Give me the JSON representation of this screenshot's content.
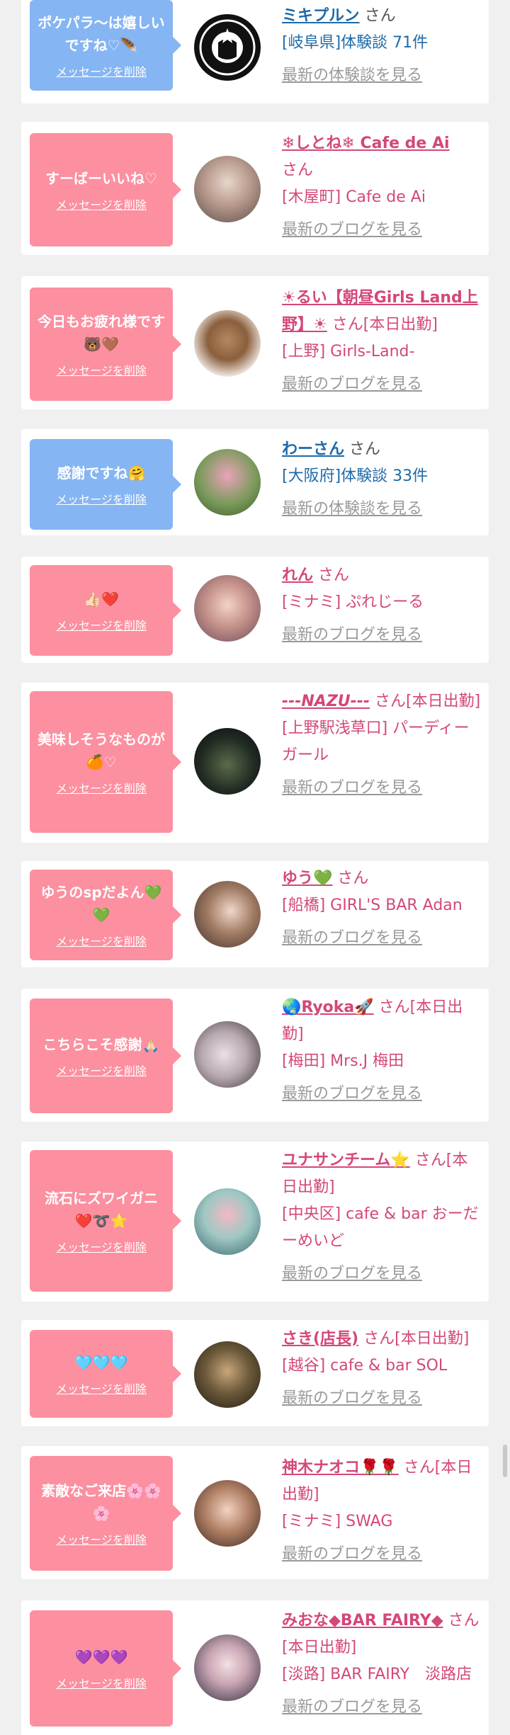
{
  "delete_label": "メッセージを削除",
  "colors": {
    "pink": "#fc8fa0",
    "blue": "#85b5f3",
    "name_pink": "#d4477a",
    "name_blue": "#1f6aa8"
  },
  "cards": [
    {
      "message": "ポケパラ〜は嬉しいですね♡🪶",
      "name": "ミキプルン",
      "suffix": "さん",
      "shop": "[岐阜県]体験談 71件",
      "link": "最新の体験談を見る",
      "avatar_icon": "starbucks-logo"
    },
    {
      "message": "すーばーいいね♡",
      "name": "❄しとね❄ Cafe de Ai",
      "suffix": "さん",
      "shop": "[木屋町] Cafe de Ai",
      "link": "最新のブログを見る",
      "avatar_icon": "profile-photo"
    },
    {
      "message": "今日もお疲れ様です🐻🤎",
      "name": "☀るい【朝昼Girls Land上野】☀",
      "suffix": "さん[本日出勤]",
      "shop": "[上野] Girls-Land-",
      "link": "最新のブログを見る",
      "avatar_icon": "bear-photo"
    },
    {
      "message": "感謝ですね🤗",
      "name": "わーさん",
      "suffix": "さん",
      "shop": "[大阪府]体験談 33件",
      "link": "最新の体験談を見る",
      "avatar_icon": "food-photo"
    },
    {
      "message": "👍🏻❤️",
      "name": "れん",
      "suffix": "さん",
      "shop": "[ミナミ] ぷれじーる",
      "link": "最新のブログを見る",
      "avatar_icon": "profile-photo"
    },
    {
      "message": "美味しそうなものが🍊♡",
      "name": "---NAZU---",
      "suffix": "さん[本日出勤]",
      "shop": "[上野駅浅草口] パーディーガール",
      "link": "最新のブログを見る",
      "avatar_icon": "night-photo"
    },
    {
      "message": "ゆうのspだよん💚💚",
      "name": "ゆう💚",
      "suffix": "さん",
      "shop": "[船橋] GIRL'S BAR Adan",
      "link": "最新のブログを見る",
      "avatar_icon": "profile-photo"
    },
    {
      "message": "こちらこそ感謝🙏🏻",
      "name": "🌏Ryoka🚀",
      "suffix": "さん[本日出勤]",
      "shop": "[梅田] Mrs.J 梅田",
      "link": "最新のブログを見る",
      "avatar_icon": "profile-photo"
    },
    {
      "message": "流石にズワイガニ❤️➰⭐",
      "name": "ユナサンチーム⭐",
      "suffix": "さん[本日出勤]",
      "shop": "[中央区] cafe & bar おーだーめいど",
      "link": "最新のブログを見る",
      "avatar_icon": "profile-photo"
    },
    {
      "message": "🩵🩵🩵",
      "name": "さき(店長)",
      "suffix": "さん[本日出勤]",
      "shop": "[越谷] cafe & bar SOL",
      "link": "最新のブログを見る",
      "avatar_icon": "bar-photo"
    },
    {
      "message": "素敵なご来店🌸🌸🌸",
      "name": "神木ナオコ🌹🌹",
      "suffix": "さん[本日出勤]",
      "shop": "[ミナミ] SWAG",
      "link": "最新のブログを見る",
      "avatar_icon": "profile-photo"
    },
    {
      "message": "💜💜💜",
      "name": "みおな◆BAR FAIRY◆",
      "suffix": "さん[本日出勤]",
      "shop": "[淡路] BAR FAIRY　淡路店",
      "link": "最新のブログを見る",
      "avatar_icon": "profile-photo"
    }
  ]
}
